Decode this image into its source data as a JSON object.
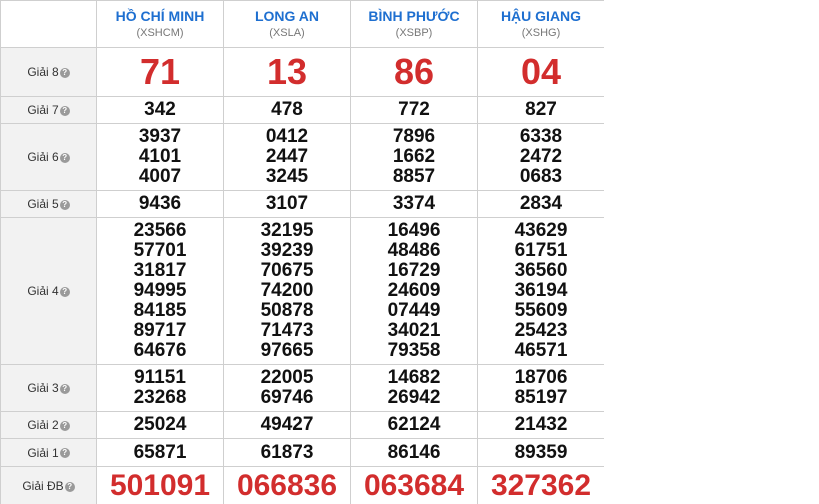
{
  "provinces": [
    {
      "name": "HỒ CHÍ MINH",
      "code": "(XSHCM)"
    },
    {
      "name": "LONG AN",
      "code": "(XSLA)"
    },
    {
      "name": "BÌNH PHƯỚC",
      "code": "(XSBP)"
    },
    {
      "name": "HẬU GIANG",
      "code": "(XSHG)"
    }
  ],
  "help_glyph": "?",
  "prizes": {
    "g8": {
      "label": "Giải 8",
      "values": [
        [
          "71"
        ],
        [
          "13"
        ],
        [
          "86"
        ],
        [
          "04"
        ]
      ]
    },
    "g7": {
      "label": "Giải 7",
      "values": [
        [
          "342"
        ],
        [
          "478"
        ],
        [
          "772"
        ],
        [
          "827"
        ]
      ]
    },
    "g6": {
      "label": "Giải 6",
      "values": [
        [
          "3937",
          "4101",
          "4007"
        ],
        [
          "0412",
          "2447",
          "3245"
        ],
        [
          "7896",
          "1662",
          "8857"
        ],
        [
          "6338",
          "2472",
          "0683"
        ]
      ]
    },
    "g5": {
      "label": "Giải 5",
      "values": [
        [
          "9436"
        ],
        [
          "3107"
        ],
        [
          "3374"
        ],
        [
          "2834"
        ]
      ]
    },
    "g4": {
      "label": "Giải 4",
      "values": [
        [
          "23566",
          "57701",
          "31817",
          "94995",
          "84185",
          "89717",
          "64676"
        ],
        [
          "32195",
          "39239",
          "70675",
          "74200",
          "50878",
          "71473",
          "97665"
        ],
        [
          "16496",
          "48486",
          "16729",
          "24609",
          "07449",
          "34021",
          "79358"
        ],
        [
          "43629",
          "61751",
          "36560",
          "36194",
          "55609",
          "25423",
          "46571"
        ]
      ]
    },
    "g3": {
      "label": "Giải 3",
      "values": [
        [
          "91151",
          "23268"
        ],
        [
          "22005",
          "69746"
        ],
        [
          "14682",
          "26942"
        ],
        [
          "18706",
          "85197"
        ]
      ]
    },
    "g2": {
      "label": "Giải 2",
      "values": [
        [
          "25024"
        ],
        [
          "49427"
        ],
        [
          "62124"
        ],
        [
          "21432"
        ]
      ]
    },
    "g1": {
      "label": "Giải 1",
      "values": [
        [
          "65871"
        ],
        [
          "61873"
        ],
        [
          "86146"
        ],
        [
          "89359"
        ]
      ]
    },
    "db": {
      "label": "Giải ĐB",
      "values": [
        [
          "501091"
        ],
        [
          "066836"
        ],
        [
          "063684"
        ],
        [
          "327362"
        ]
      ]
    }
  }
}
